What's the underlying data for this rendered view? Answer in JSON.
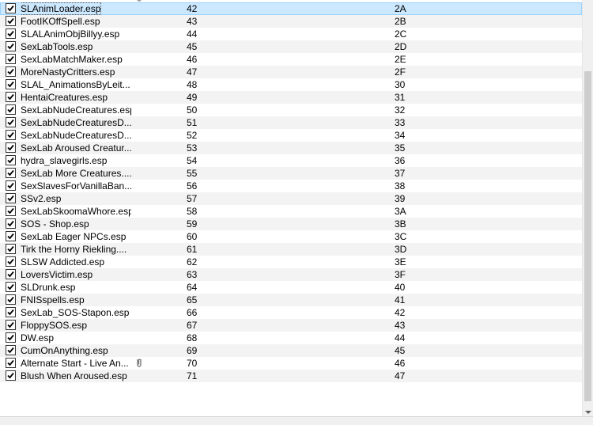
{
  "plugins": [
    {
      "name": "SLAnimLoader.esp",
      "index": "42",
      "hex": "2A",
      "checked": true,
      "selected": true
    },
    {
      "name": "FootIKOffSpell.esp",
      "index": "43",
      "hex": "2B",
      "checked": true
    },
    {
      "name": "SLALAnimObjBillyy.esp",
      "index": "44",
      "hex": "2C",
      "checked": true
    },
    {
      "name": "SexLabTools.esp",
      "index": "45",
      "hex": "2D",
      "checked": true
    },
    {
      "name": "SexLabMatchMaker.esp",
      "index": "46",
      "hex": "2E",
      "checked": true
    },
    {
      "name": "MoreNastyCritters.esp",
      "index": "47",
      "hex": "2F",
      "checked": true
    },
    {
      "name": "SLAL_AnimationsByLeit...",
      "index": "48",
      "hex": "30",
      "checked": true
    },
    {
      "name": "HentaiCreatures.esp",
      "index": "49",
      "hex": "31",
      "checked": true
    },
    {
      "name": "SexLabNudeCreatures.esp",
      "index": "50",
      "hex": "32",
      "checked": true
    },
    {
      "name": "SexLabNudeCreaturesD...",
      "index": "51",
      "hex": "33",
      "checked": true
    },
    {
      "name": "SexLabNudeCreaturesD...",
      "index": "52",
      "hex": "34",
      "checked": true
    },
    {
      "name": "SexLab Aroused Creatur...",
      "index": "53",
      "hex": "35",
      "checked": true
    },
    {
      "name": "hydra_slavegirls.esp",
      "index": "54",
      "hex": "36",
      "checked": true
    },
    {
      "name": "SexLab More Creatures....",
      "index": "55",
      "hex": "37",
      "checked": true
    },
    {
      "name": "SexSlavesForVanillaBan...",
      "index": "56",
      "hex": "38",
      "checked": true
    },
    {
      "name": "SSv2.esp",
      "index": "57",
      "hex": "39",
      "checked": true
    },
    {
      "name": "SexLabSkoomaWhore.esp",
      "index": "58",
      "hex": "3A",
      "checked": true
    },
    {
      "name": "SOS - Shop.esp",
      "index": "59",
      "hex": "3B",
      "checked": true
    },
    {
      "name": "SexLab Eager NPCs.esp",
      "index": "60",
      "hex": "3C",
      "checked": true
    },
    {
      "name": "Tirk the Horny Riekling....",
      "index": "61",
      "hex": "3D",
      "checked": true
    },
    {
      "name": "SLSW Addicted.esp",
      "index": "62",
      "hex": "3E",
      "checked": true
    },
    {
      "name": "LoversVictim.esp",
      "index": "63",
      "hex": "3F",
      "checked": true
    },
    {
      "name": "SLDrunk.esp",
      "index": "64",
      "hex": "40",
      "checked": true
    },
    {
      "name": "FNISspells.esp",
      "index": "65",
      "hex": "41",
      "checked": true
    },
    {
      "name": "SexLab_SOS-Stapon.esp",
      "index": "66",
      "hex": "42",
      "checked": true
    },
    {
      "name": "FloppySOS.esp",
      "index": "67",
      "hex": "43",
      "checked": true
    },
    {
      "name": "DW.esp",
      "index": "68",
      "hex": "44",
      "checked": true
    },
    {
      "name": "CumOnAnything.esp",
      "index": "69",
      "hex": "45",
      "checked": true
    },
    {
      "name": "Alternate Start - Live An...",
      "index": "70",
      "hex": "46",
      "checked": true,
      "icon": "paperclip-icon"
    },
    {
      "name": "Blush When Aroused.esp",
      "index": "71",
      "hex": "47",
      "checked": true
    }
  ],
  "icons": {
    "checkbox": "checkmark-icon",
    "attachment": "paperclip-icon",
    "scroll_down": "scroll-down-arrow-icon"
  },
  "colors": {
    "selected_row": "#cce8ff",
    "alt_row": "#f3f3f3"
  }
}
